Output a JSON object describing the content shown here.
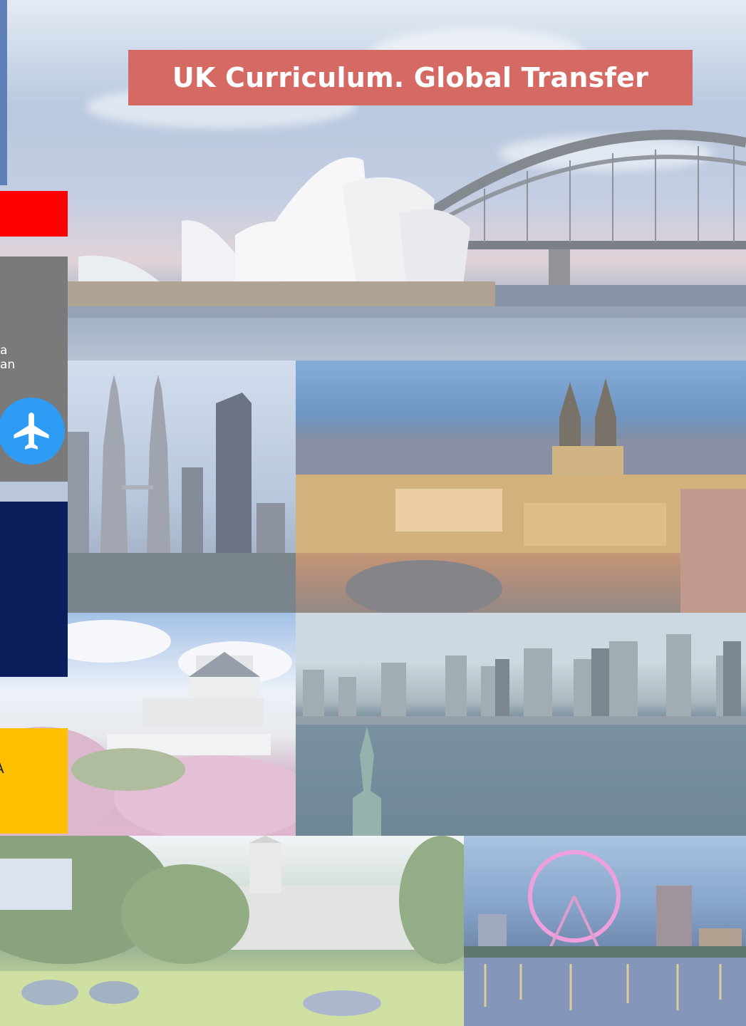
{
  "banner": {
    "headline": "UK Curriculum. Global Transfer"
  },
  "side_panel": {
    "fragment_1": "a",
    "fragment_2": "an",
    "plane_button_icon": "airplane-icon"
  },
  "side_blocks": {
    "yellow_fragment": "A"
  },
  "colors": {
    "headline_bg": "#d56a64",
    "red_block": "#ff0000",
    "grey_panel": "#7a7a7a",
    "plane_button": "#2e9cf4",
    "navy_block": "#0a1f5c",
    "yellow_block": "#ffc000",
    "pale_tab": "#dce3ee"
  }
}
